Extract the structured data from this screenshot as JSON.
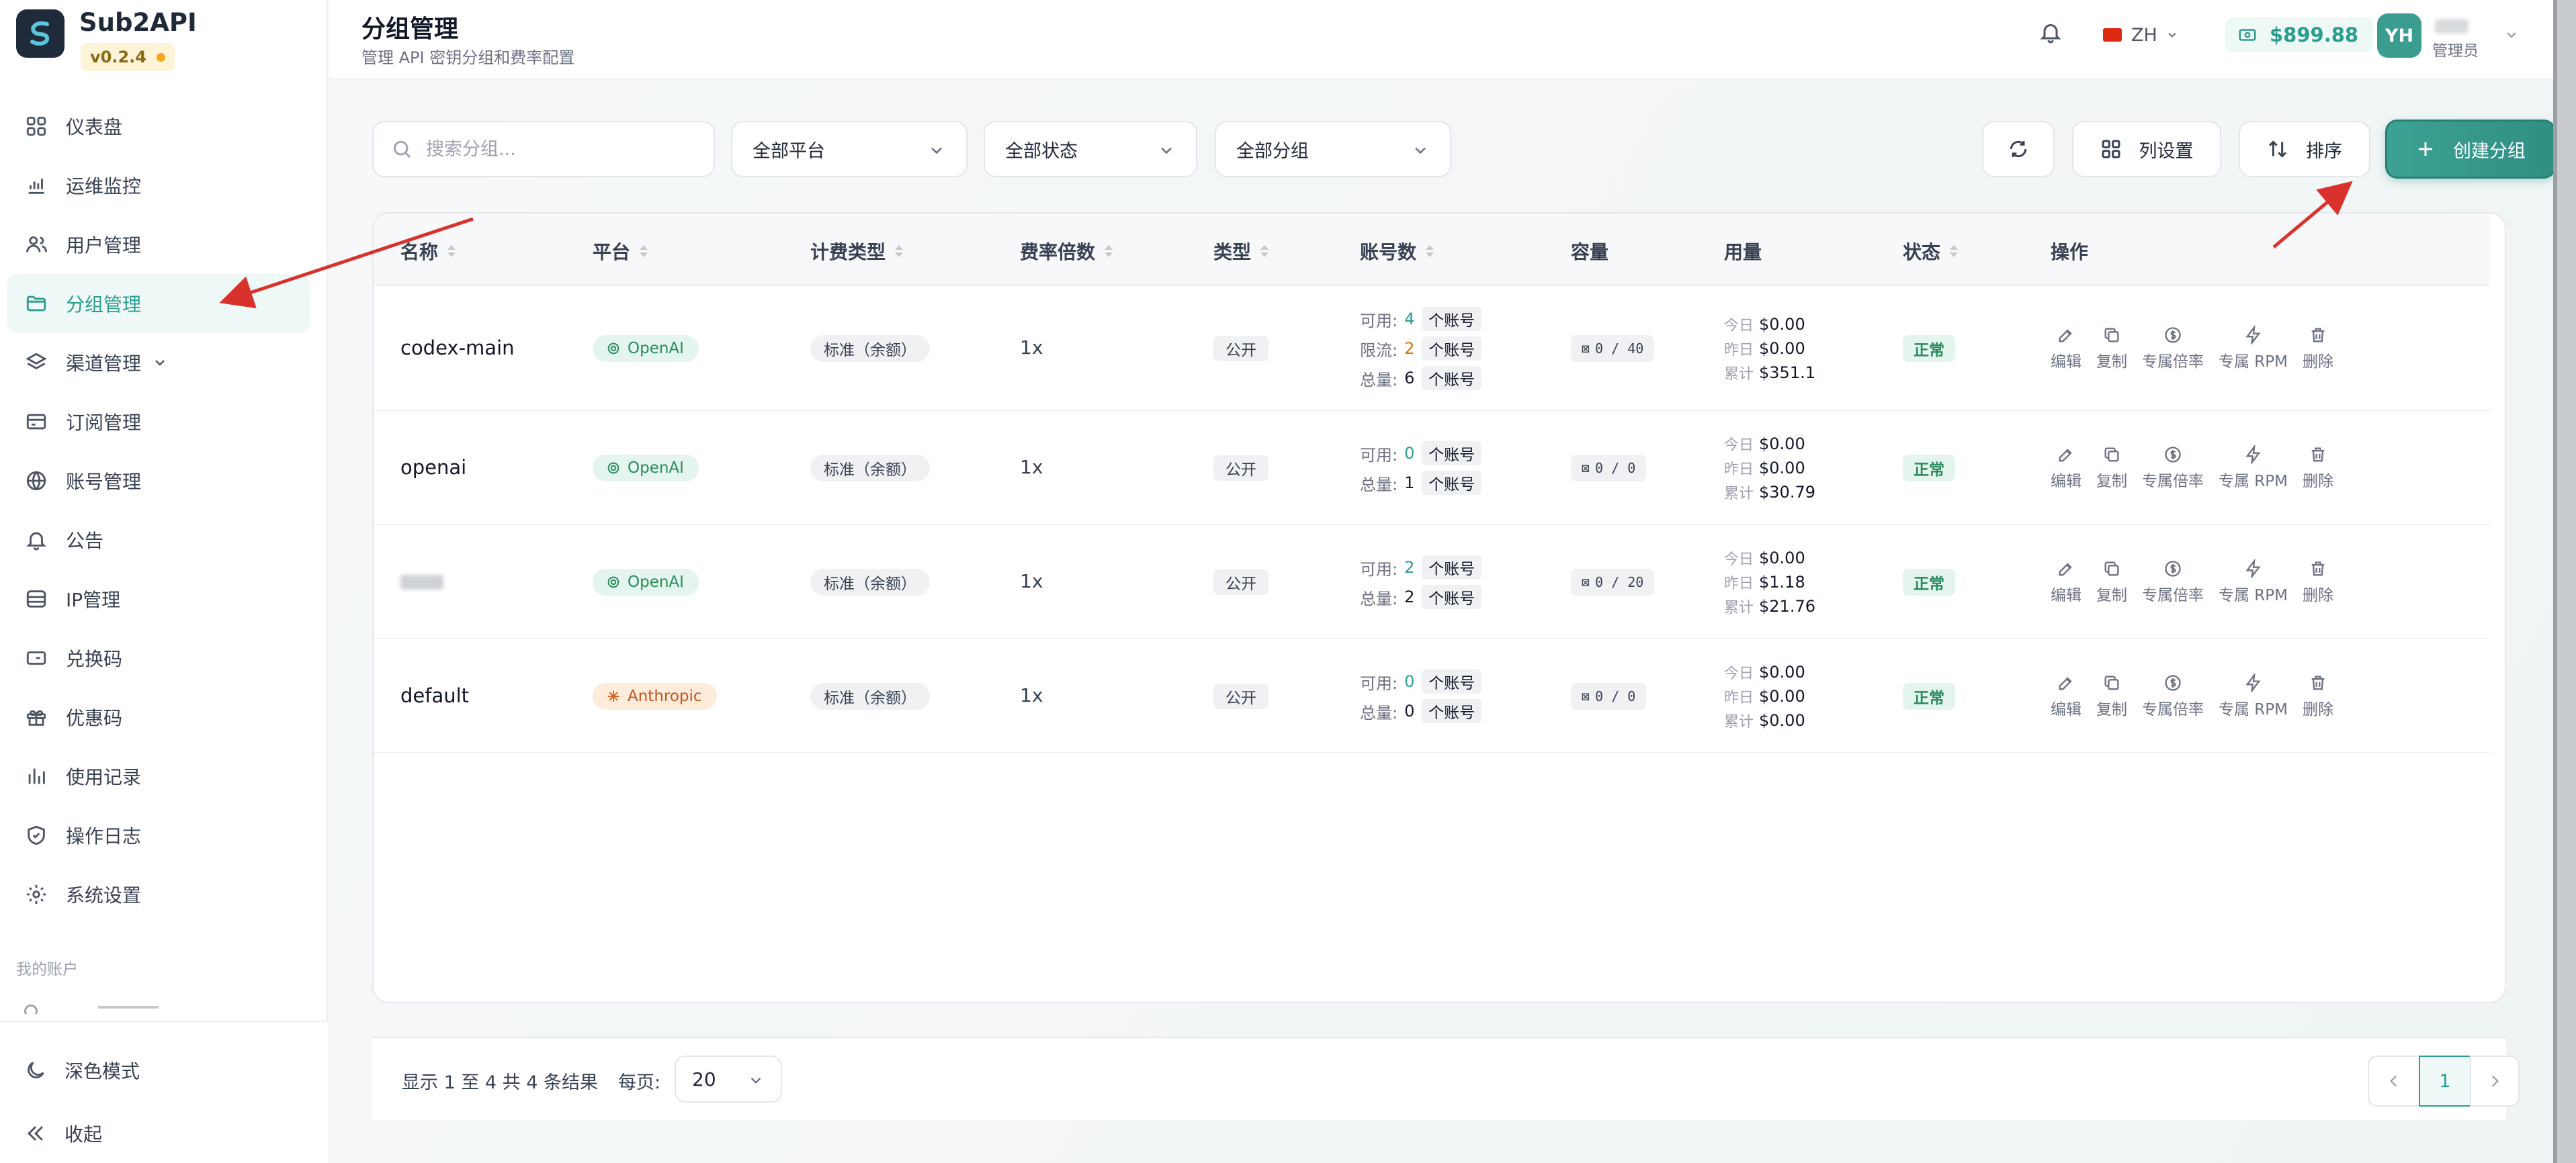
{
  "brand": {
    "name": "Sub2API",
    "version": "v0.2.4"
  },
  "sidebar": {
    "items": [
      {
        "label": "仪表盘",
        "icon": "dashboard-icon"
      },
      {
        "label": "运维监控",
        "icon": "chart-icon"
      },
      {
        "label": "用户管理",
        "icon": "users-icon"
      },
      {
        "label": "分组管理",
        "icon": "folder-icon",
        "active": true
      },
      {
        "label": "渠道管理",
        "icon": "layers-icon",
        "has_chevron": true
      },
      {
        "label": "订阅管理",
        "icon": "card-icon"
      },
      {
        "label": "账号管理",
        "icon": "globe-icon"
      },
      {
        "label": "公告",
        "icon": "bell-icon"
      },
      {
        "label": "IP管理",
        "icon": "database-icon"
      },
      {
        "label": "兑换码",
        "icon": "ticket-icon"
      },
      {
        "label": "优惠码",
        "icon": "gift-icon"
      },
      {
        "label": "使用记录",
        "icon": "bar-chart-icon"
      },
      {
        "label": "操作日志",
        "icon": "shield-icon"
      },
      {
        "label": "系统设置",
        "icon": "gear-icon"
      }
    ],
    "section_label": "我的账户",
    "dark_mode": "深色模式",
    "collapse": "收起"
  },
  "header": {
    "title": "分组管理",
    "subtitle": "管理 API 密钥分组和费率配置",
    "lang": "ZH",
    "balance": "$899.88",
    "avatar": "YH",
    "role": "管理员"
  },
  "toolbar": {
    "search_placeholder": "搜索分组...",
    "platform_filter": "全部平台",
    "status_filter": "全部状态",
    "group_filter": "全部分组",
    "columns_label": "列设置",
    "sort_label": "排序",
    "create_label": "创建分组"
  },
  "table": {
    "headers": [
      "名称",
      "平台",
      "计费类型",
      "费率倍数",
      "类型",
      "账号数",
      "容量",
      "用量",
      "状态",
      "操作"
    ],
    "actions": [
      "编辑",
      "复制",
      "专属倍率",
      "专属 RPM",
      "删除"
    ],
    "account_labels": {
      "available": "可用:",
      "limited": "限流:",
      "total": "总量:",
      "unit": "个账号"
    },
    "usage_labels": {
      "today": "今日",
      "yesterday": "昨日",
      "total": "累计"
    },
    "rows": [
      {
        "name": "codex-main",
        "platform": "OpenAI",
        "billing": "标准（余额）",
        "rate": "1x",
        "type": "公开",
        "available": "4",
        "limited": "2",
        "total": "6",
        "capacity": "0 / 40",
        "today": "$0.00",
        "yesterday": "$0.00",
        "cumulative": "$351.1",
        "status": "正常"
      },
      {
        "name": "openai",
        "platform": "OpenAI",
        "billing": "标准（余额）",
        "rate": "1x",
        "type": "公开",
        "available": "0",
        "total": "1",
        "capacity": "0 / 0",
        "today": "$0.00",
        "yesterday": "$0.00",
        "cumulative": "$30.79",
        "status": "正常"
      },
      {
        "name": "",
        "platform": "OpenAI",
        "billing": "标准（余额）",
        "rate": "1x",
        "type": "公开",
        "available": "2",
        "total": "2",
        "capacity": "0 / 20",
        "today": "$0.00",
        "yesterday": "$1.18",
        "cumulative": "$21.76",
        "status": "正常"
      },
      {
        "name": "default",
        "platform": "Anthropic",
        "billing": "标准（余额）",
        "rate": "1x",
        "type": "公开",
        "available": "0",
        "total": "0",
        "capacity": "0 / 0",
        "today": "$0.00",
        "yesterday": "$0.00",
        "cumulative": "$0.00",
        "status": "正常"
      }
    ]
  },
  "pagination": {
    "info": "显示 1 至 4 共 4 条结果",
    "per_page_label": "每页:",
    "per_page": "20",
    "current_page": "1"
  },
  "colors": {
    "accent": "#2a9d8f",
    "annotation_arrow": "#d9322c"
  }
}
